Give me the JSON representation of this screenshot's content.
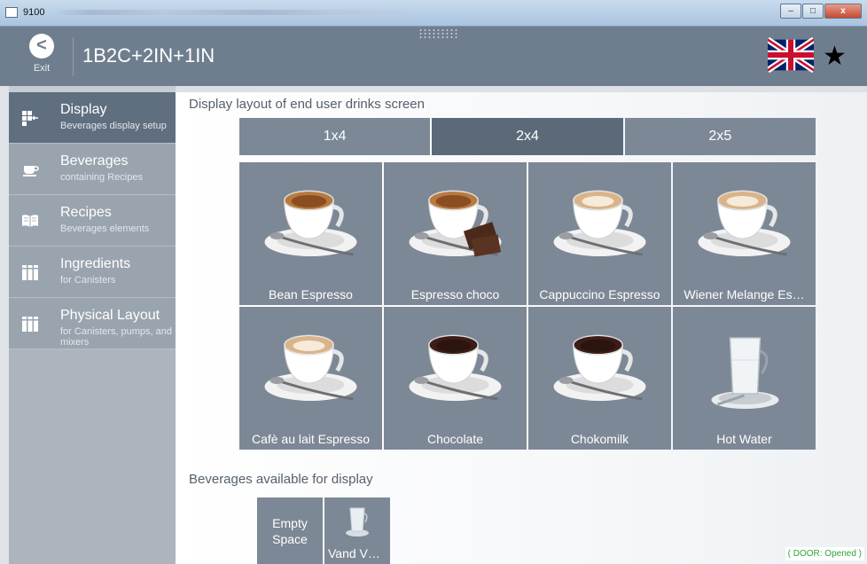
{
  "window": {
    "title": "9100",
    "buttons": {
      "minimize": "–",
      "maximize": "□",
      "close": "x"
    }
  },
  "header": {
    "exit_label": "Exit",
    "exit_glyph": "<",
    "title": "1B2C+2IN+1IN",
    "star": "★"
  },
  "sidebar": {
    "items": [
      {
        "title": "Display",
        "subtitle": "Beverages display setup",
        "icon": "display-layout-icon",
        "active": true
      },
      {
        "title": "Beverages",
        "subtitle": "containing Recipes",
        "icon": "cup-icon",
        "active": false
      },
      {
        "title": "Recipes",
        "subtitle": "Beverages elements",
        "icon": "book-icon",
        "active": false
      },
      {
        "title": "Ingredients",
        "subtitle": "for Canisters",
        "icon": "canisters-icon",
        "active": false
      },
      {
        "title": "Physical Layout",
        "subtitle": "for Canisters, pumps, and mixers",
        "icon": "physical-layout-icon",
        "active": false
      }
    ]
  },
  "main": {
    "section_title": "Display layout of end user drinks screen",
    "tabs": [
      {
        "label": "1x4",
        "active": false
      },
      {
        "label": "2x4",
        "active": true
      },
      {
        "label": "2x5",
        "active": false
      }
    ],
    "drinks": [
      {
        "label": "Bean Espresso",
        "image": "espresso"
      },
      {
        "label": "Espresso choco",
        "image": "espresso-choco"
      },
      {
        "label": "Cappuccino Espresso",
        "image": "cappuccino"
      },
      {
        "label": "Wiener Melange Es…",
        "image": "cappuccino"
      },
      {
        "label": "Cafè au lait Espresso",
        "image": "cappuccino"
      },
      {
        "label": "Chocolate",
        "image": "chocolate"
      },
      {
        "label": "Chokomilk",
        "image": "chocolate"
      },
      {
        "label": "Hot Water",
        "image": "water-glass"
      }
    ],
    "available_title": "Beverages available for display",
    "available": [
      {
        "label": "Empty Space"
      },
      {
        "label": "Vand V…"
      }
    ],
    "door_status": "( DOOR: Opened )"
  },
  "colors": {
    "header": "#6f7e8f",
    "tile": "#7c8896",
    "active": "#5b6978",
    "door": "#2fa33a"
  }
}
